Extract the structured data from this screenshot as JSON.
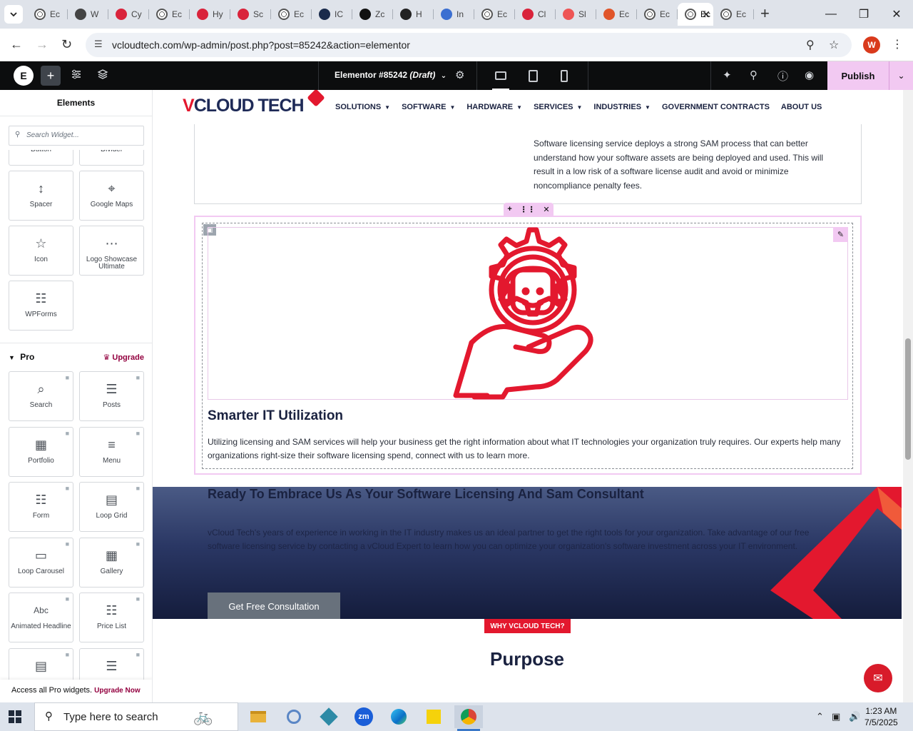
{
  "browser": {
    "tabs": [
      {
        "label": "Ec",
        "icon": "globe-icon"
      },
      {
        "label": "W",
        "icon": "wordpress-icon"
      },
      {
        "label": "Cy",
        "icon": "diamond-icon"
      },
      {
        "label": "Ec",
        "icon": "globe-icon"
      },
      {
        "label": "Hy",
        "icon": "diamond-icon"
      },
      {
        "label": "Sc",
        "icon": "diamond-icon"
      },
      {
        "label": "Ec",
        "icon": "globe-icon"
      },
      {
        "label": "IC",
        "icon": "ic-icon"
      },
      {
        "label": "Zc",
        "icon": "z-icon"
      },
      {
        "label": "H",
        "icon": "circle-icon"
      },
      {
        "label": "In",
        "icon": "cloud-icon"
      },
      {
        "label": "Ec",
        "icon": "globe-icon"
      },
      {
        "label": "Cl",
        "icon": "swoosh-icon"
      },
      {
        "label": "Sl",
        "icon": "ring-icon"
      },
      {
        "label": "Ec",
        "icon": "box-icon"
      },
      {
        "label": "Ec",
        "icon": "globe-icon"
      },
      {
        "label": "Ec",
        "icon": "globe-icon",
        "active": true
      },
      {
        "label": "Ec",
        "icon": "globe-icon"
      }
    ],
    "url": "vcloudtech.com/wp-admin/post.php?post=85242&action=elementor",
    "profile_initial": "W"
  },
  "elementor": {
    "doc_title": "Elementor #85242",
    "doc_status": "(Draft)",
    "publish_label": "Publish",
    "panel_title": "Elements",
    "search_placeholder": "Search Widget...",
    "basic_widgets": [
      {
        "label": "Button",
        "icon": "button-icon"
      },
      {
        "label": "Divider",
        "icon": "divider-icon"
      },
      {
        "label": "Spacer",
        "icon": "spacer-icon"
      },
      {
        "label": "Google Maps",
        "icon": "map-icon"
      },
      {
        "label": "Icon",
        "icon": "star-icon"
      },
      {
        "label": "Logo Showcase Ultimate",
        "icon": "logo-showcase-icon"
      },
      {
        "label": "WPForms",
        "icon": "form-icon"
      }
    ],
    "pro_label": "Pro",
    "upgrade_label": "Upgrade",
    "pro_widgets": [
      {
        "label": "Search",
        "icon": "search-widget-icon"
      },
      {
        "label": "Posts",
        "icon": "posts-icon"
      },
      {
        "label": "Portfolio",
        "icon": "portfolio-icon"
      },
      {
        "label": "Menu",
        "icon": "menu-icon"
      },
      {
        "label": "Form",
        "icon": "form-icon"
      },
      {
        "label": "Loop Grid",
        "icon": "loop-grid-icon"
      },
      {
        "label": "Loop Carousel",
        "icon": "carousel-icon"
      },
      {
        "label": "Gallery",
        "icon": "gallery-icon"
      },
      {
        "label": "Animated Headline",
        "icon": "headline-icon"
      },
      {
        "label": "Price List",
        "icon": "price-list-icon"
      },
      {
        "label": "",
        "icon": "price-table-icon"
      },
      {
        "label": "",
        "icon": "flip-box-icon"
      }
    ],
    "footer_text": "Access all Pro widgets.",
    "footer_link": "Upgrade Now"
  },
  "site": {
    "logo_text": "VCLOUD TECH",
    "menu": [
      {
        "label": "SOLUTIONS",
        "dropdown": true
      },
      {
        "label": "SOFTWARE",
        "dropdown": true
      },
      {
        "label": "HARDWARE",
        "dropdown": true
      },
      {
        "label": "SERVICES",
        "dropdown": true
      },
      {
        "label": "INDUSTRIES",
        "dropdown": true
      },
      {
        "label": "GOVERNMENT CONTRACTS",
        "dropdown": false
      },
      {
        "label": "ABOUT US",
        "dropdown": false
      }
    ],
    "sam_paragraph": "Software licensing service deploys a strong SAM process that can better understand how your software assets are being deployed and used. This will result in a low risk of a software license audit and avoid or minimize noncompliance penalty fees.",
    "box_title": "Smarter IT Utilization",
    "box_text": "Utilizing licensing and SAM services will help your business get the right information about what IT technologies your organization truly requires. Our experts help many organizations right-size their software licensing spend, connect with us to learn more.",
    "cta_title": "Ready To Embrace Us As Your Software Licensing And Sam Consultant",
    "cta_text": "vCloud Tech's years of experience in working in the IT industry makes us an ideal partner to get the right tools for your organization. Take advantage of our free software licensing service by contacting a vCloud Expert to learn how you can optimize your organization's software investment across your IT environment.",
    "cta_button": "Get Free Consultation",
    "why_badge": "WHY VCLOUD TECH?",
    "purpose_heading": "Purpose",
    "brand_red": "#e3182e",
    "brand_navy": "#1a2240"
  },
  "taskbar": {
    "search_placeholder": "Type here to search",
    "time": "1:23 AM",
    "date": "7/5/2025",
    "apps": [
      "file-explorer-icon",
      "network-icon",
      "app-icon",
      "zoom-icon",
      "edge-icon",
      "sticky-notes-icon",
      "chrome-icon"
    ]
  }
}
